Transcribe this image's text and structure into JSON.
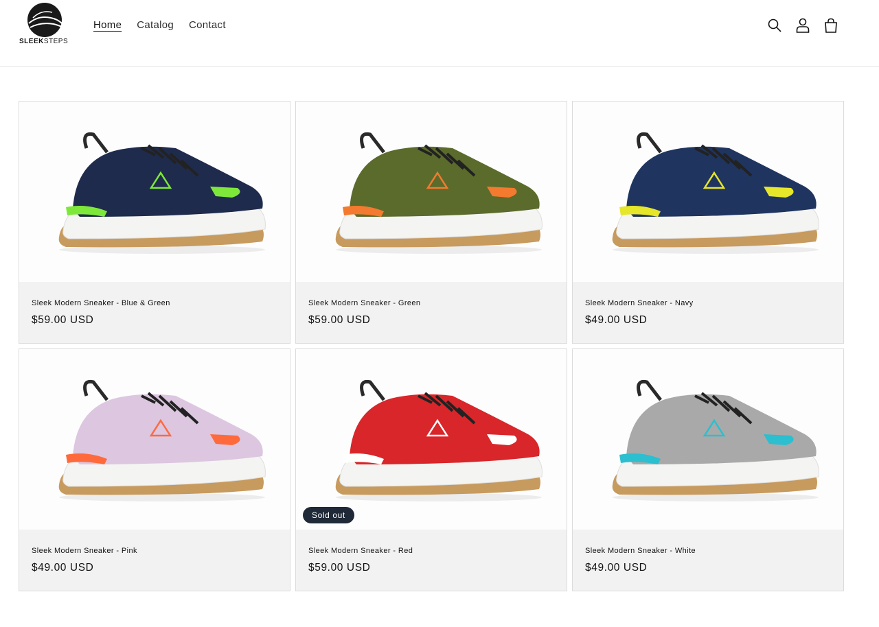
{
  "brand": {
    "name_bold": "SLEEK",
    "name_light": "STEPS"
  },
  "nav": {
    "items": [
      {
        "label": "Home",
        "active": true
      },
      {
        "label": "Catalog",
        "active": false
      },
      {
        "label": "Contact",
        "active": false
      }
    ]
  },
  "header_icons": [
    "search-icon",
    "account-icon",
    "cart-icon"
  ],
  "products": [
    {
      "title": "Sleek Modern Sneaker - Blue & Green",
      "price": "$59.00 USD",
      "upper": "#1f2b4d",
      "accent": "#7ee83a",
      "sold_out": false
    },
    {
      "title": "Sleek Modern Sneaker - Green",
      "price": "$59.00 USD",
      "upper": "#5b6b2c",
      "accent": "#f37a2e",
      "sold_out": false
    },
    {
      "title": "Sleek Modern Sneaker - Navy",
      "price": "$49.00 USD",
      "upper": "#1f3560",
      "accent": "#e6e62a",
      "sold_out": false
    },
    {
      "title": "Sleek Modern Sneaker - Pink",
      "price": "$49.00 USD",
      "upper": "#dcc6e0",
      "accent": "#ff6a3d",
      "sold_out": false
    },
    {
      "title": "Sleek Modern Sneaker - Red",
      "price": "$59.00 USD",
      "upper": "#d8262a",
      "accent": "#ffffff",
      "sold_out": true,
      "badge": "Sold out"
    },
    {
      "title": "Sleek Modern Sneaker - White",
      "price": "$49.00 USD",
      "upper": "#a9a9a9",
      "accent": "#2bbfcf",
      "sold_out": false
    }
  ]
}
